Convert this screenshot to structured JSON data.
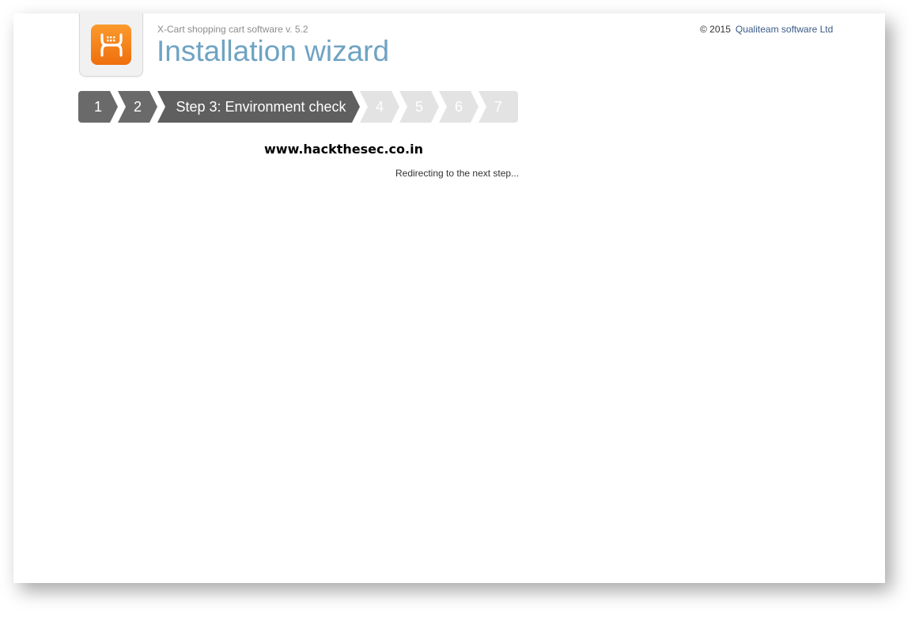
{
  "header": {
    "subtitle": "X-Cart shopping cart software v. 5.2",
    "title": "Installation wizard",
    "copyright_prefix": "© 2015",
    "company_link": "Qualiteam software Ltd"
  },
  "steps": [
    {
      "label": "1",
      "state": "done"
    },
    {
      "label": "2",
      "state": "done"
    },
    {
      "label": "Step 3: Environment check",
      "state": "active"
    },
    {
      "label": "4",
      "state": "todo"
    },
    {
      "label": "5",
      "state": "todo"
    },
    {
      "label": "6",
      "state": "todo"
    },
    {
      "label": "7",
      "state": "todo"
    }
  ],
  "watermark": "www.hackthesec.co.in",
  "status": "Redirecting to the next step...",
  "colors": {
    "title": "#6fa3c3",
    "step_done": "#6a6a6a",
    "step_todo": "#e3e3e3",
    "logo": "#f7871e",
    "link": "#3a5a86"
  },
  "icons": {
    "logo": "xcart-logo-icon"
  }
}
